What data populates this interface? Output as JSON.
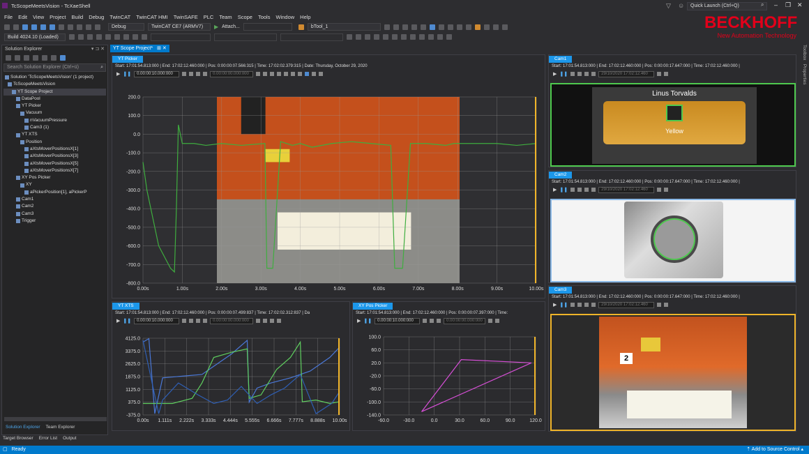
{
  "window": {
    "title": "TcScopeMeetsVision - TcXaeShell",
    "quick_launch": "Quick Launch (Ctrl+Q)"
  },
  "brand": {
    "name": "BECKHOFF",
    "tagline": "New Automation Technology",
    "color": "#e2001a"
  },
  "menu": [
    "File",
    "Edit",
    "View",
    "Project",
    "Build",
    "Debug",
    "TwinCAT",
    "TwinCAT HMI",
    "TwinSAFE",
    "PLC",
    "Team",
    "Scope",
    "Tools",
    "Window",
    "Help"
  ],
  "toolbar": {
    "config": "Debug",
    "platform": "TwinCAT CE7 (ARMV7)",
    "attach": "Attach...",
    "tool": "bTool_1",
    "build": "Build 4024.10 (Loaded)"
  },
  "solution_explorer": {
    "title": "Solution Explorer",
    "search_placeholder": "Search Solution Explorer (Ctrl+ü)",
    "items": [
      "Solution 'TcScopeMeetsVision' (1 project)",
      "TcScopeMeetsVision",
      "YT Scope Project",
      "DataPool",
      "YT Picker",
      "Vacuum",
      "nVacuumPressure",
      "Cam3 (1)",
      "YT XTS",
      "Position",
      "aXtsMoverPositionsX[1]",
      "aXtsMoverPositionsX[3]",
      "aXtsMoverPositionsX[5]",
      "aXtsMoverPositionsX[7]",
      "XY Pos Picker",
      "XY",
      "aPickerPosition[1], aPickerP",
      "Cam1",
      "Cam2",
      "Cam3",
      "Trigger"
    ],
    "bottom_tabs": [
      "Solution Explorer",
      "Team Explorer"
    ],
    "output_tabs": [
      "Target Browser",
      "Error List",
      "Output"
    ]
  },
  "document_tab": "YT Scope Project*",
  "yt_picker": {
    "tab": "YT Picker",
    "info": "Start:  17:01:54.813:000  |  End:  17:02:12.460:000  |  Pos:  0:00:00:07.566:315  |  Time:  17:02:02.379:315  |  Date:  Thursday, October 29, 2020",
    "timebox": "0.00:00:10.000:000",
    "timebox2": "0.00:00:00.000:000"
  },
  "yt_xts": {
    "tab": "YT XTS",
    "info": "Start:  17:01:54.813:000  |  End:  17:02:12.460:000  |  Pos:  0:00:00:07.499:837  |  Time:  17:02:02.312:837  |  Da",
    "timebox": "0.00:00:10.000:000",
    "timebox2": "0.00:00:00.000:000"
  },
  "xy_pos": {
    "tab": "XY Pos Picker",
    "info": "Start:  17:01:54.813:000  |  End:  17:02:12.460:000  |  Pos:  0:00:00:07.397:000  |  Time:",
    "timebox": "0.00:00:10.000:000",
    "timebox2": "0.00:00:00.000:000"
  },
  "cams": [
    {
      "tab": "Cam1",
      "info": "Start:  17:01:54.813:000  |  End:  17:02:12.460:000  |  Pos:  0:00:00:17.647:000  |  Time:  17:02:12.460:000  |",
      "date": "29/10/2020  17:02:12.460",
      "label_top": "Linus Torvalds",
      "label_bottom": "Yellow",
      "border": "#4ec94e"
    },
    {
      "tab": "Cam2",
      "info": "Start:  17:01:54.813:000  |  End:  17:02:12.460:000  |  Pos:  0:00:00:17.647:000  |  Time:  17:02:12.460:000  |",
      "date": "29/10/2020  17:02:12.460",
      "border": "#8ab8e6"
    },
    {
      "tab": "Cam3",
      "info": "Start:  17:01:54.813:000  |  End:  17:02:12.460:000  |  Pos:  0:00:00:17.647:000  |  Time:  17:02:12.460:000  |",
      "date": "29/10/2020  17:02:12.460",
      "label_number": "2",
      "border": "#f0b429"
    }
  ],
  "status": {
    "ready": "Ready",
    "source_control": "Add to Source Control"
  },
  "chart_data": [
    {
      "type": "line",
      "name": "YT Picker",
      "x_ticks": [
        "0.00s",
        "1.00s",
        "2.00s",
        "3.00s",
        "4.00s",
        "5.00s",
        "6.00s",
        "7.00s",
        "8.00s",
        "9.00s",
        "10.00s"
      ],
      "y_ticks": [
        "200.0",
        "100.0",
        "0.0",
        "-100.0",
        "-200.0",
        "-300.0",
        "-400.0",
        "-500.0",
        "-600.0",
        "-700.0",
        "-800.0"
      ],
      "xlim": [
        0,
        10
      ],
      "ylim": [
        -800,
        200
      ],
      "series": [
        {
          "color": "#3fae3f",
          "x": [
            0,
            0.1,
            0.4,
            0.7,
            0.8,
            0.85,
            0.9,
            1.0,
            1.3,
            1.6,
            2.0,
            2.5,
            3.1,
            3.15,
            3.3,
            3.5,
            3.8,
            4.0,
            4.3,
            4.8,
            5.3,
            5.8,
            6.3,
            6.4,
            6.6,
            6.8,
            7.2,
            7.7,
            7.9,
            8.2,
            8.6,
            9.0,
            9.5,
            10
          ],
          "values": [
            -150,
            -300,
            -600,
            -720,
            -740,
            -400,
            50,
            -50,
            -50,
            -60,
            -50,
            -60,
            -50,
            -720,
            -720,
            -40,
            -60,
            -50,
            -70,
            -50,
            -40,
            -50,
            -60,
            -720,
            -720,
            -50,
            -50,
            -60,
            -50,
            -50,
            -50,
            -50,
            -60,
            -50
          ]
        }
      ]
    },
    {
      "type": "line",
      "name": "YT XTS",
      "x_ticks": [
        "0.00s",
        "1.111s",
        "2.222s",
        "3.333s",
        "4.444s",
        "5.555s",
        "6.666s",
        "7.777s",
        "8.888s",
        "10.00s"
      ],
      "y_ticks": [
        "4125.0",
        "3375.0",
        "2625.0",
        "1875.0",
        "1125.0",
        "375.0",
        "-375.0"
      ],
      "xlim": [
        0,
        10
      ],
      "ylim": [
        -375,
        4125
      ],
      "series": [
        {
          "color": "#4a78d8",
          "x": [
            0,
            0.3,
            0.6,
            1.0,
            2.0,
            3.0,
            3.5,
            4.5,
            5.3,
            5.4,
            5.8,
            6.5,
            7.5,
            8.5,
            9.5,
            10
          ],
          "values": [
            3900,
            4100,
            -300,
            1800,
            1900,
            2000,
            2400,
            3200,
            4000,
            375,
            1200,
            1500,
            1800,
            2200,
            3000,
            3600
          ]
        },
        {
          "color": "#5fcf5f",
          "x": [
            0,
            1.5,
            2.5,
            3.0,
            3.6,
            4.5,
            5.3,
            5.4,
            6.0,
            6.8,
            7.5,
            8.0,
            8.1,
            8.8,
            9.5,
            10
          ],
          "values": [
            300,
            300,
            600,
            1500,
            3000,
            3300,
            3500,
            600,
            800,
            2300,
            3000,
            3900,
            400,
            500,
            300,
            400
          ]
        },
        {
          "color": "#2f5fb5",
          "x": [
            0,
            0.8,
            1.0,
            1.8,
            2.8,
            3.6,
            4.3,
            5.0,
            5.8,
            6.5,
            7.2,
            8.0,
            8.8,
            9.6,
            10
          ],
          "values": [
            4000,
            -300,
            500,
            1500,
            800,
            300,
            500,
            1300,
            300,
            800,
            1200,
            2000,
            -300,
            300,
            1000
          ]
        }
      ]
    },
    {
      "type": "line",
      "name": "XY Pos Picker",
      "x_ticks": [
        "-60.0",
        "-30.0",
        "0.0",
        "30.0",
        "60.0",
        "90.0",
        "120.0"
      ],
      "y_ticks": [
        "100.0",
        "60.0",
        "20.0",
        "-20.0",
        "-60.0",
        "-100.0",
        "-140.0"
      ],
      "xlim": [
        -60,
        120
      ],
      "ylim": [
        -140,
        100
      ],
      "series": [
        {
          "color": "#d64fd6",
          "x": [
            -15,
            32,
            115,
            -15
          ],
          "values": [
            -130,
            30,
            20,
            -130
          ]
        }
      ]
    }
  ]
}
